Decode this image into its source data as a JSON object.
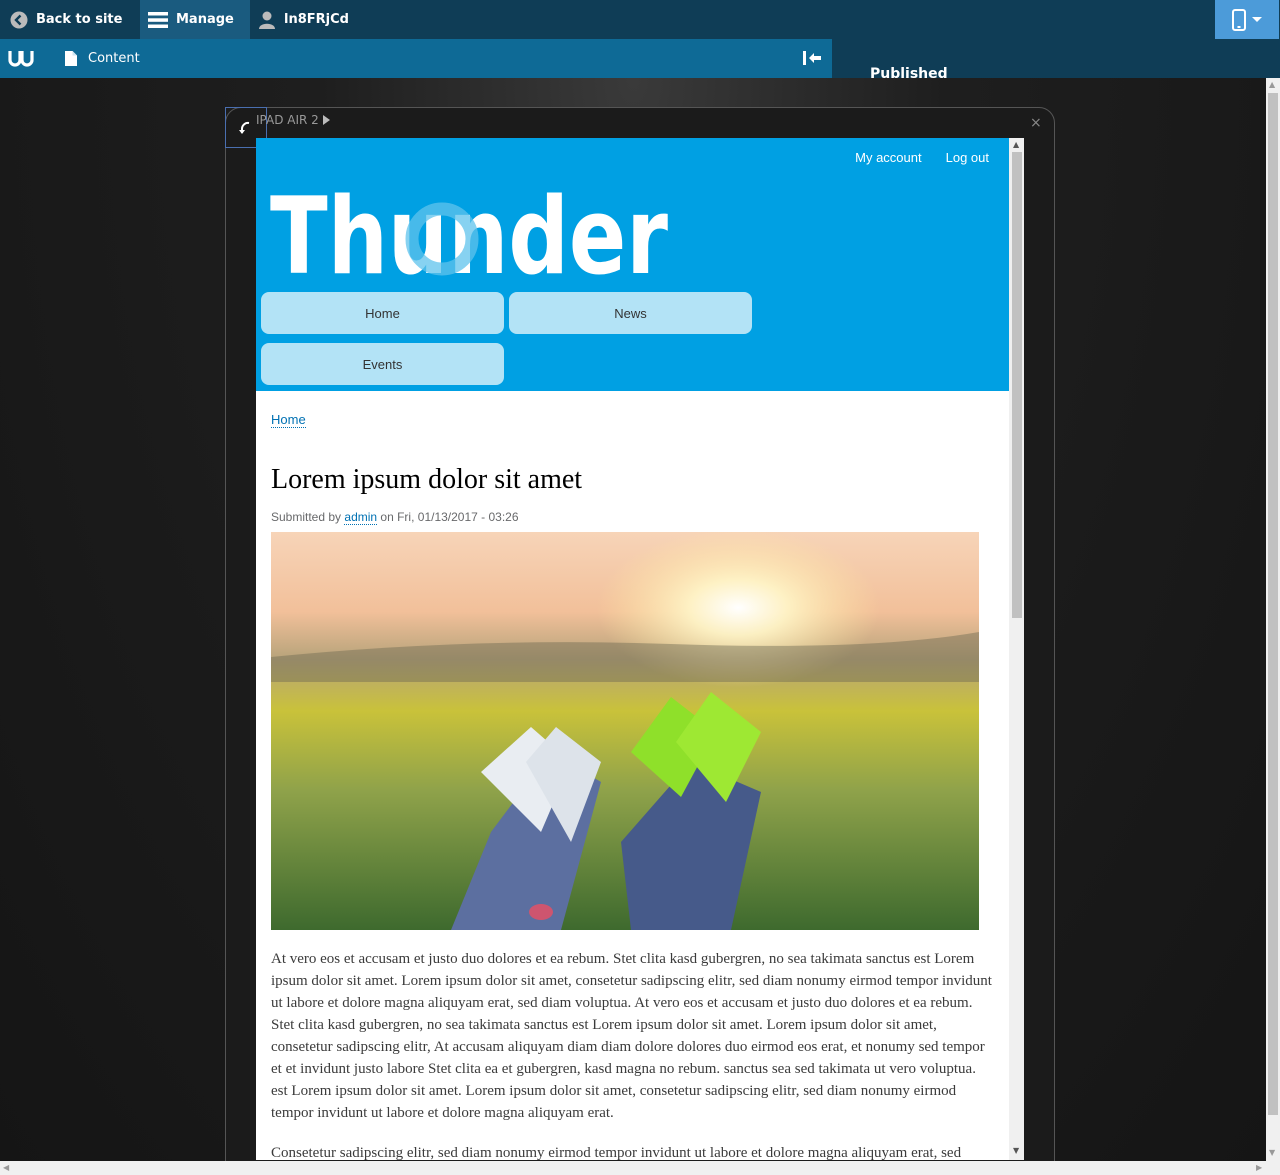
{
  "toolbar": {
    "back_label": "Back to site",
    "manage_label": "Manage",
    "user_label": "ln8FRjCd",
    "content_label": "Content",
    "published_label": "Published"
  },
  "device": {
    "name": "IPAD AIR 2",
    "close_glyph": "×"
  },
  "site": {
    "secondary_nav": [
      "My account",
      "Log out"
    ],
    "logo_text": "Thunder",
    "menu": [
      "Home",
      "News",
      "Events"
    ]
  },
  "article": {
    "breadcrumb": "Home",
    "title": "Lorem ipsum dolor sit amet",
    "submitted_prefix": "Submitted by",
    "author": "admin",
    "submitted_suffix": "on Fri, 01/13/2017 - 03:26",
    "paragraphs": [
      "At vero eos et accusam et justo duo dolores et ea rebum. Stet clita kasd gubergren, no sea takimata sanctus est Lorem ipsum dolor sit amet. Lorem ipsum dolor sit amet, consetetur sadipscing elitr, sed diam nonumy eirmod tempor invidunt ut labore et dolore magna aliquyam erat, sed diam voluptua. At vero eos et accusam et justo duo dolores et ea rebum. Stet clita kasd gubergren, no sea takimata sanctus est Lorem ipsum dolor sit amet. Lorem ipsum dolor sit amet, consetetur sadipscing elitr, At accusam aliquyam diam diam dolore dolores duo eirmod eos erat, et nonumy sed tempor et et invidunt justo labore Stet clita ea et gubergren, kasd magna no rebum. sanctus sea sed takimata ut vero voluptua. est Lorem ipsum dolor sit amet. Lorem ipsum dolor sit amet, consetetur sadipscing elitr, sed diam nonumy eirmod tempor invidunt ut labore et dolore magna aliquyam erat.",
      "Consetetur sadipscing elitr, sed diam nonumy eirmod tempor invidunt ut labore et dolore magna aliquyam erat, sed"
    ]
  },
  "colors": {
    "admin_bar": "#0f3d56",
    "tray": "#0e6a96",
    "site_header": "#00a0e3",
    "menu_item": "#b3e3f6",
    "link": "#0071b3"
  },
  "icons": [
    "back-circle-icon",
    "hamburger-icon",
    "user-icon",
    "mobile-device-icon",
    "thunder-logo-icon",
    "document-icon",
    "collapse-tray-icon",
    "rotate-icon",
    "play-triangle-icon"
  ]
}
